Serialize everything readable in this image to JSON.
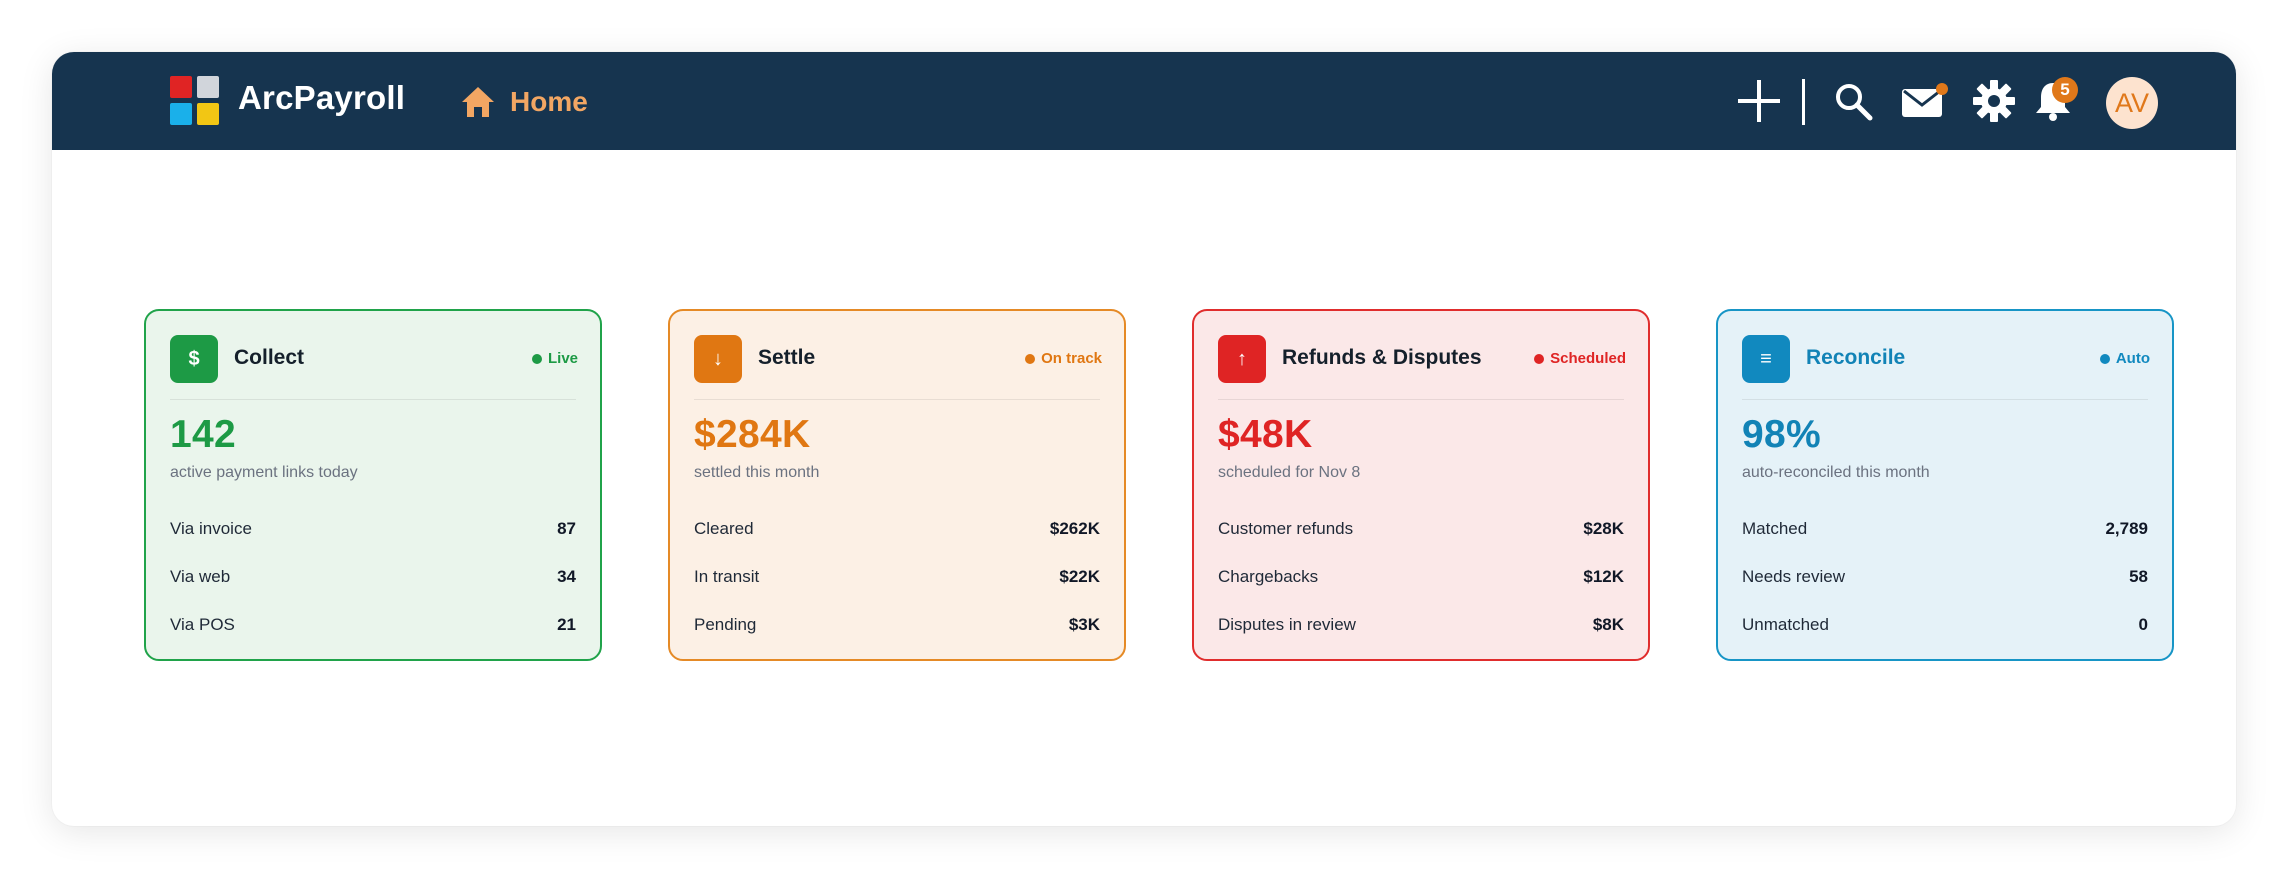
{
  "app": {
    "brand": "ArcPayroll",
    "nav": {
      "home_label": "Home"
    },
    "notifications_count": "5",
    "avatar_initials": "AV",
    "icons": [
      "plus-icon",
      "search-icon",
      "mail-icon",
      "gear-icon",
      "bell-icon",
      "home-icon"
    ]
  },
  "colors": {
    "topbar": "#16344f",
    "home_accent": "#f2a663",
    "notification_badge": "#e0781a",
    "collect": "#1d9a45",
    "settle": "#e07712",
    "refunds": "#df2424",
    "reconcile": "#1189bf"
  },
  "cards": [
    {
      "icon": "$",
      "title": "Collect",
      "status": "Live",
      "metric": "142",
      "sub": "active payment links today",
      "rows": [
        {
          "label": "Via invoice",
          "value": "87"
        },
        {
          "label": "Via web",
          "value": "34"
        },
        {
          "label": "Via POS",
          "value": "21"
        }
      ]
    },
    {
      "icon": "↓",
      "title": "Settle",
      "status": "On track",
      "metric": "$284K",
      "sub": "settled this month",
      "rows": [
        {
          "label": "Cleared",
          "value": "$262K"
        },
        {
          "label": "In transit",
          "value": "$22K"
        },
        {
          "label": "Pending",
          "value": "$3K"
        }
      ]
    },
    {
      "icon": "↑",
      "title": "Refunds & Disputes",
      "status": "Scheduled",
      "metric": "$48K",
      "sub": "scheduled for Nov 8",
      "rows": [
        {
          "label": "Customer refunds",
          "value": "$28K"
        },
        {
          "label": "Chargebacks",
          "value": "$12K"
        },
        {
          "label": "Disputes in review",
          "value": "$8K"
        }
      ]
    },
    {
      "icon": "≡",
      "title": "Reconcile",
      "status": "Auto",
      "metric": "98%",
      "sub": "auto-reconciled this month",
      "rows": [
        {
          "label": "Matched",
          "value": "2,789"
        },
        {
          "label": "Needs review",
          "value": "58"
        },
        {
          "label": "Unmatched",
          "value": "0"
        }
      ]
    }
  ]
}
